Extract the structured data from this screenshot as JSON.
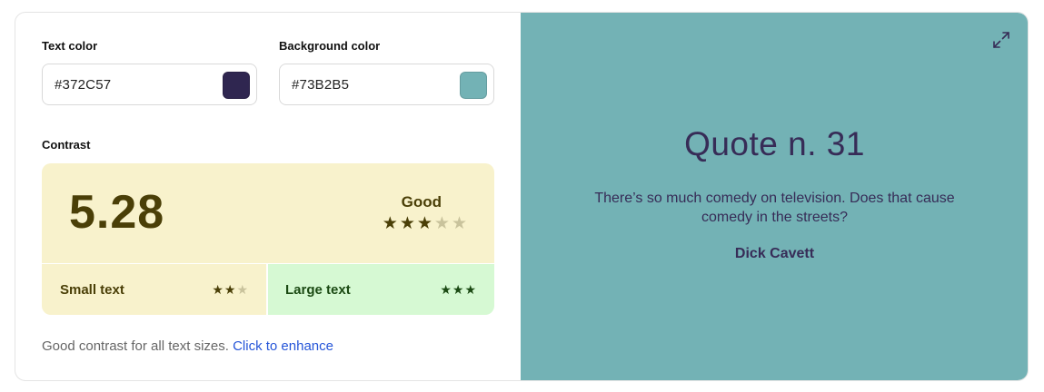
{
  "text_color": {
    "label": "Text color",
    "value": "#372C57",
    "swatch_color": "#2f2650"
  },
  "background_color": {
    "label": "Background color",
    "value": "#73B2B5",
    "swatch_color": "#73b2b5"
  },
  "contrast": {
    "label": "Contrast",
    "ratio": "5.28",
    "rating_label": "Good",
    "rating_stars": 3,
    "rating_max": 5,
    "panel_color": "#f8f2cc",
    "text_color": "#4a3f07",
    "small_text": {
      "label": "Small text",
      "stars": 2,
      "max": 3,
      "background": "#f8f2cc",
      "text_color": "#4a3f07"
    },
    "large_text": {
      "label": "Large text",
      "stars": 3,
      "max": 3,
      "background": "#d6f9d3",
      "text_color": "#1b4a13"
    }
  },
  "footer": {
    "message": "Good contrast for all text sizes.",
    "link": "Click to enhance"
  },
  "preview": {
    "title": "Quote n. 31",
    "quote": "There’s so much comedy on television. Does that cause comedy in the streets?",
    "author": "Dick Cavett",
    "icon": "expand-icon"
  },
  "colors": {
    "star_off": "#c9c39c",
    "link": "#2555d8"
  }
}
